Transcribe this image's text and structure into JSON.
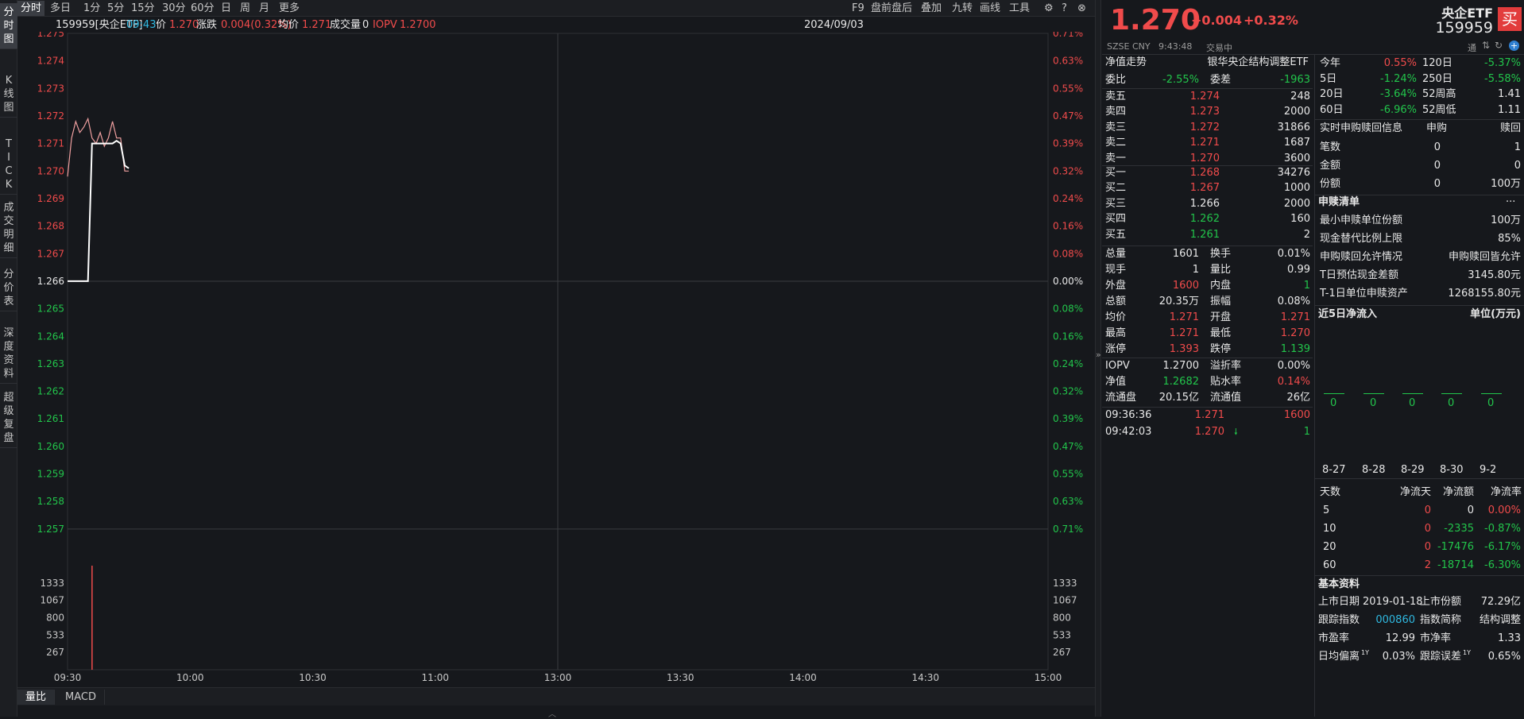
{
  "sidebar_tabs": [
    {
      "label": "分时图",
      "chars": [
        "分",
        "时",
        "图"
      ]
    },
    {
      "label": "K线图",
      "chars": [
        "K",
        "线",
        "图"
      ]
    },
    {
      "label": "TICK",
      "chars": [
        "T",
        "I",
        "C",
        "K"
      ]
    },
    {
      "label": "成交明细",
      "chars": [
        "成",
        "交",
        "明",
        "细"
      ]
    },
    {
      "label": "分价表",
      "chars": [
        "分",
        "价",
        "表"
      ]
    },
    {
      "label": "深度资料",
      "chars": [
        "深",
        "度",
        "资",
        "料"
      ]
    },
    {
      "label": "超级复盘",
      "chars": [
        "超",
        "级",
        "复",
        "盘"
      ]
    }
  ],
  "periods": [
    "分时",
    "多日",
    "1分",
    "5分",
    "15分",
    "30分",
    "60分",
    "日",
    "周",
    "月",
    "更多"
  ],
  "active_period": "分时",
  "tools": [
    "F9",
    "盘前盘后",
    "叠加",
    "九转",
    "画线",
    "工具"
  ],
  "info": {
    "code_name": "159959[央企ETF]",
    "time": "09:43",
    "price_label": "价",
    "price": "1.270",
    "change_label": "涨跌",
    "change": "0.004(0.32%)",
    "avg_label": "均价",
    "avg": "1.271",
    "volume_label": "成交量",
    "volume": "0",
    "iopv_label": "IOPV",
    "iopv": "1.2700",
    "date": "2024/09/03"
  },
  "chart_data": {
    "type": "line",
    "price_axis": {
      "ticks": [
        "1.275",
        "1.274",
        "1.273",
        "1.272",
        "1.271",
        "1.270",
        "1.269",
        "1.268",
        "1.267",
        "1.266",
        "1.265",
        "1.264",
        "1.263",
        "1.262",
        "1.261",
        "1.260",
        "1.259",
        "1.258",
        "1.257"
      ],
      "pct_ticks": [
        "0.71%",
        "0.63%",
        "0.55%",
        "0.47%",
        "0.39%",
        "0.32%",
        "0.24%",
        "0.16%",
        "0.08%",
        "0.00%",
        "0.08%",
        "0.16%",
        "0.24%",
        "0.32%",
        "0.39%",
        "0.47%",
        "0.55%",
        "0.63%",
        "0.71%"
      ],
      "ylim": [
        1.257,
        1.275
      ],
      "prev_close": 1.266
    },
    "volume_axis": {
      "ticks": [
        "1333",
        "1067",
        "800",
        "533",
        "267"
      ],
      "ylim": [
        0,
        1600
      ]
    },
    "time_ticks": [
      "09:30",
      "10:00",
      "10:30",
      "11:00",
      "13:00",
      "13:30",
      "14:00",
      "14:30",
      "15:00"
    ],
    "series": [
      {
        "name": "价",
        "color": "#f0a0a0",
        "values": [
          [
            0,
            1.2698
          ],
          [
            1,
            1.2712
          ],
          [
            2,
            1.2718
          ],
          [
            3,
            1.2714
          ],
          [
            4,
            1.2716
          ],
          [
            5,
            1.2719
          ],
          [
            6,
            1.2712
          ],
          [
            7,
            1.271
          ],
          [
            8,
            1.2714
          ],
          [
            9,
            1.2709
          ],
          [
            10,
            1.2712
          ],
          [
            11,
            1.2718
          ],
          [
            12,
            1.2712
          ],
          [
            13,
            1.2712
          ],
          [
            14,
            1.27
          ],
          [
            15,
            1.27
          ]
        ]
      },
      {
        "name": "均价",
        "color": "#ffffff",
        "values": [
          [
            0,
            1.266
          ],
          [
            5,
            1.266
          ],
          [
            6,
            1.271
          ],
          [
            11,
            1.271
          ],
          [
            12,
            1.2711
          ],
          [
            13,
            1.271
          ],
          [
            14,
            1.2702
          ],
          [
            15,
            1.2701
          ]
        ]
      }
    ],
    "volume_bars": [
      [
        6,
        1600
      ]
    ]
  },
  "bottom_tabs": [
    "量比",
    "MACD"
  ],
  "quote": {
    "price": "1.270",
    "change": "+0.004",
    "change_pct": "+0.32%",
    "name": "央企ETF",
    "code": "159959",
    "buy_button": "买",
    "exchange": "SZSE",
    "currency": "CNY",
    "time": "9:43:48",
    "status": "交易中",
    "badge": "通",
    "icons": [
      "up-down-arrows-icon",
      "refresh-icon",
      "plus-circle-icon"
    ]
  },
  "nav_title": "净值走势",
  "fund_full_name": "银华央企结构调整ETF",
  "weibi": {
    "label1": "委比",
    "value1": "-2.55%",
    "label2": "委差",
    "value2": "-1963"
  },
  "asks": [
    {
      "label": "卖五",
      "price": "1.274",
      "vol": "248"
    },
    {
      "label": "卖四",
      "price": "1.273",
      "vol": "2000"
    },
    {
      "label": "卖三",
      "price": "1.272",
      "vol": "31866"
    },
    {
      "label": "卖二",
      "price": "1.271",
      "vol": "1687"
    },
    {
      "label": "卖一",
      "price": "1.270",
      "vol": "3600"
    }
  ],
  "bids": [
    {
      "label": "买一",
      "price": "1.268",
      "vol": "34276"
    },
    {
      "label": "买二",
      "price": "1.267",
      "vol": "1000"
    },
    {
      "label": "买三",
      "price": "1.266",
      "vol": "2000"
    },
    {
      "label": "买四",
      "price": "1.262",
      "vol": "160"
    },
    {
      "label": "买五",
      "price": "1.261",
      "vol": "2"
    }
  ],
  "stats": [
    {
      "l1": "总量",
      "v1": "1601",
      "c1": "white",
      "l2": "换手",
      "v2": "0.01%",
      "c2": "white"
    },
    {
      "l1": "现手",
      "v1": "1",
      "c1": "white",
      "l2": "量比",
      "v2": "0.99",
      "c2": "white"
    },
    {
      "l1": "外盘",
      "v1": "1600",
      "c1": "red",
      "l2": "内盘",
      "v2": "1",
      "c2": "green"
    },
    {
      "l1": "总额",
      "v1": "20.35万",
      "c1": "white",
      "l2": "振幅",
      "v2": "0.08%",
      "c2": "white"
    },
    {
      "l1": "均价",
      "v1": "1.271",
      "c1": "red",
      "l2": "开盘",
      "v2": "1.271",
      "c2": "red"
    },
    {
      "l1": "最高",
      "v1": "1.271",
      "c1": "red",
      "l2": "最低",
      "v2": "1.270",
      "c2": "red"
    },
    {
      "l1": "涨停",
      "v1": "1.393",
      "c1": "red",
      "l2": "跌停",
      "v2": "1.139",
      "c2": "green"
    }
  ],
  "stats2": [
    {
      "l1": "IOPV",
      "v1": "1.2700",
      "c1": "white",
      "l2": "溢折率",
      "v2": "0.00%",
      "c2": "white"
    },
    {
      "l1": "净值",
      "v1": "1.2682",
      "c1": "green",
      "l2": "贴水率",
      "v2": "0.14%",
      "c2": "red"
    },
    {
      "l1": "流通盘",
      "v1": "20.15亿",
      "c1": "white",
      "l2": "流通值",
      "v2": "26亿",
      "c2": "white"
    }
  ],
  "trades": [
    {
      "time": "09:36:36",
      "price": "1.271",
      "vol": "1600",
      "arrow": ""
    },
    {
      "time": "09:42:03",
      "price": "1.270",
      "vol": "1",
      "arrow": "🠗"
    }
  ],
  "performance": [
    {
      "l1": "今年",
      "v1": "0.55%",
      "c1": "red",
      "l2": "120日",
      "v2": "-5.37%",
      "c2": "green"
    },
    {
      "l1": "5日",
      "v1": "-1.24%",
      "c1": "green",
      "l2": "250日",
      "v2": "-5.58%",
      "c2": "green"
    },
    {
      "l1": "20日",
      "v1": "-3.64%",
      "c1": "green",
      "l2": "52周高",
      "v2": "1.41",
      "c2": "white"
    },
    {
      "l1": "60日",
      "v1": "-6.96%",
      "c1": "green",
      "l2": "52周低",
      "v2": "1.11",
      "c2": "white"
    }
  ],
  "subscription": {
    "title": "实时申购赎回信息",
    "col1": "申购",
    "col2": "赎回",
    "rows": [
      {
        "label": "笔数",
        "v1": "0",
        "v2": "1"
      },
      {
        "label": "金额",
        "v1": "0",
        "v2": "0"
      },
      {
        "label": "份额",
        "v1": "0",
        "v2": "100万"
      }
    ]
  },
  "creation_list": {
    "title": "申赎清单",
    "more": "···",
    "rows": [
      {
        "label": "最小申赎单位份额",
        "value": "100万"
      },
      {
        "label": "现金替代比例上限",
        "value": "85%"
      },
      {
        "label": "申购赎回允许情况",
        "value": "申购赎回皆允许"
      },
      {
        "label": "T日预估现金差额",
        "value": "3145.80元"
      },
      {
        "label": "T-1日单位申赎资产",
        "value": "1268155.80元"
      }
    ]
  },
  "netflow": {
    "title": "近5日净流入",
    "unit": "单位(万元)",
    "values": [
      "0",
      "0",
      "0",
      "0",
      "0"
    ],
    "dates": [
      "8-27",
      "8-28",
      "8-29",
      "8-30",
      "9-2"
    ],
    "table_header": [
      "天数",
      "净流天",
      "净流额",
      "净流率"
    ],
    "rows": [
      {
        "days": "5",
        "flow_days": "0",
        "flow_amt": "0",
        "flow_rate": "0.00%",
        "c_days": "red",
        "c_amt": "white",
        "c_rate": "red"
      },
      {
        "days": "10",
        "flow_days": "0",
        "flow_amt": "-2335",
        "flow_rate": "-0.87%",
        "c_days": "red",
        "c_amt": "green",
        "c_rate": "green"
      },
      {
        "days": "20",
        "flow_days": "0",
        "flow_amt": "-17476",
        "flow_rate": "-6.17%",
        "c_days": "red",
        "c_amt": "green",
        "c_rate": "green"
      },
      {
        "days": "60",
        "flow_days": "2",
        "flow_amt": "-18714",
        "flow_rate": "-6.30%",
        "c_days": "red",
        "c_amt": "green",
        "c_rate": "green"
      }
    ]
  },
  "basic": {
    "title": "基本资料",
    "rows": [
      {
        "l1": "上市日期",
        "v1": "2019-01-18",
        "c1": "white",
        "l2": "上市份额",
        "v2": "72.29亿",
        "c2": "white"
      },
      {
        "l1": "跟踪指数",
        "v1": "000860",
        "c1": "cyan",
        "l2": "指数简称",
        "v2": "结构调整",
        "c2": "white"
      },
      {
        "l1": "市盈率",
        "v1": "12.99",
        "c1": "white",
        "l2": "市净率",
        "v2": "1.33",
        "c2": "white"
      },
      {
        "l1": "日均偏离",
        "sup1": "1Y",
        "v1": "0.03%",
        "c1": "white",
        "l2": "跟踪误差",
        "sup2": "1Y",
        "v2": "0.65%",
        "c2": "white"
      }
    ]
  }
}
